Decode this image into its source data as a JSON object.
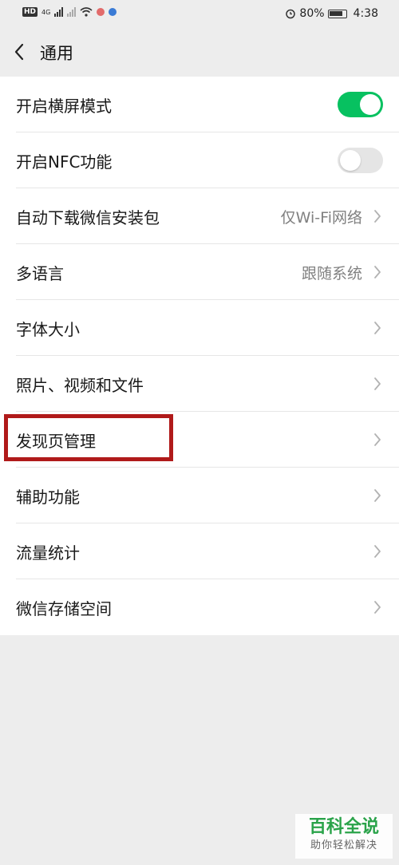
{
  "status_bar": {
    "network": "4G",
    "battery": "80%",
    "time": "4:38"
  },
  "nav": {
    "title": "通用"
  },
  "settings": {
    "landscape": {
      "label": "开启横屏模式",
      "enabled": true
    },
    "nfc": {
      "label": "开启NFC功能",
      "enabled": false
    },
    "auto_download": {
      "label": "自动下载微信安装包",
      "value": "仅Wi-Fi网络"
    },
    "language": {
      "label": "多语言",
      "value": "跟随系统"
    },
    "font_size": {
      "label": "字体大小"
    },
    "media": {
      "label": "照片、视频和文件"
    },
    "discover": {
      "label": "发现页管理"
    },
    "accessibility": {
      "label": "辅助功能"
    },
    "traffic": {
      "label": "流量统计"
    },
    "storage": {
      "label": "微信存储空间"
    }
  },
  "watermark": {
    "title": "百科全说",
    "subtitle": "助你轻松解决"
  },
  "colors": {
    "toggle_on": "#07c160",
    "highlight": "#b01a1a"
  }
}
